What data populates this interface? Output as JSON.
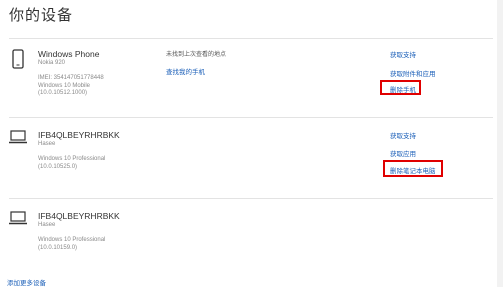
{
  "page": {
    "title": "你的设备"
  },
  "devices": [
    {
      "name": "Windows Phone",
      "info": [
        "Nokia 920",
        "",
        "IMEI: 354147051778448",
        "Windows 10 Mobile",
        "(10.0.10512.1000)"
      ],
      "location_text": "未找到上次查看的地点",
      "find_link": "查找我的手机",
      "actions": [
        "获取支持",
        "获取附件和应用",
        "删除手机"
      ],
      "highlight_color": "#e00000"
    },
    {
      "name": "IFB4QLBEYRHRBKK",
      "info": [
        "Hasee",
        "",
        "Windows 10 Professional",
        "(10.0.10525.0)"
      ],
      "actions": [
        "获取支持",
        "获取应用",
        "删除笔记本电脑"
      ],
      "highlight_color": "#e00000"
    },
    {
      "name": "IFB4QLBEYRHRBKK",
      "info": [
        "Hasee",
        "",
        "Windows 10 Professional",
        "(10.0.10159.0)"
      ],
      "actions": []
    }
  ],
  "footer": {
    "add_more_link": "添加更多设备"
  },
  "colors": {
    "link": "#1b5fb8",
    "highlight": "#e00000",
    "divider": "#e3e3e3"
  },
  "icons": {
    "phone": "phone-icon",
    "laptop": "laptop-icon"
  }
}
